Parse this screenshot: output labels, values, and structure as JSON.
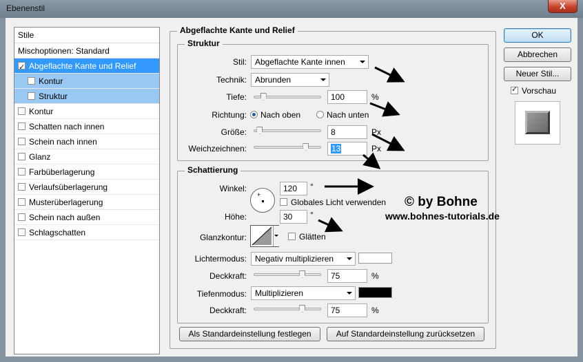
{
  "window": {
    "title": "Ebenenstil",
    "close_label": "X"
  },
  "styles_list": {
    "header": "Stile",
    "blend_options": "Mischoptionen: Standard",
    "items": [
      {
        "label": "Abgeflachte Kante und Relief",
        "checked": true,
        "selected": true,
        "sub": false
      },
      {
        "label": "Kontur",
        "checked": false,
        "selected": false,
        "sub": true
      },
      {
        "label": "Struktur",
        "checked": false,
        "selected": false,
        "sub": true
      },
      {
        "label": "Kontur",
        "checked": false,
        "selected": false,
        "sub": false
      },
      {
        "label": "Schatten nach innen",
        "checked": false,
        "selected": false,
        "sub": false
      },
      {
        "label": "Schein nach innen",
        "checked": false,
        "selected": false,
        "sub": false
      },
      {
        "label": "Glanz",
        "checked": false,
        "selected": false,
        "sub": false
      },
      {
        "label": "Farbüberlagerung",
        "checked": false,
        "selected": false,
        "sub": false
      },
      {
        "label": "Verlaufsüberlagerung",
        "checked": false,
        "selected": false,
        "sub": false
      },
      {
        "label": "Musterüberlagerung",
        "checked": false,
        "selected": false,
        "sub": false
      },
      {
        "label": "Schein nach außen",
        "checked": false,
        "selected": false,
        "sub": false
      },
      {
        "label": "Schlagschatten",
        "checked": false,
        "selected": false,
        "sub": false
      }
    ]
  },
  "bevel": {
    "title": "Abgeflachte Kante und Relief",
    "structure": {
      "title": "Struktur",
      "style_label": "Stil:",
      "style_value": "Abgeflachte Kante innen",
      "technique_label": "Technik:",
      "technique_value": "Abrunden",
      "depth_label": "Tiefe:",
      "depth_value": "100",
      "depth_unit": "%",
      "depth_fraction": 0.1,
      "direction_label": "Richtung:",
      "direction_up": "Nach oben",
      "direction_down": "Nach unten",
      "size_label": "Größe:",
      "size_value": "8",
      "size_unit": "Px",
      "size_fraction": 0.04,
      "soften_label": "Weichzeichnen:",
      "soften_value": "13",
      "soften_unit": "Px",
      "soften_fraction": 0.81
    },
    "shading": {
      "title": "Schattierung",
      "angle_label": "Winkel:",
      "angle_value": "120",
      "angle_unit": "°",
      "global_light_label": "Globales Licht verwenden",
      "altitude_label": "Höhe:",
      "altitude_value": "30",
      "altitude_unit": "°",
      "gloss_label": "Glanzkontur:",
      "antialias_label": "Glätten",
      "highlight_mode_label": "Lichtermodus:",
      "highlight_mode_value": "Negativ multiplizieren",
      "highlight_color": "#ffffff",
      "highlight_opacity_label": "Deckkraft:",
      "highlight_opacity_value": "75",
      "highlight_opacity_unit": "%",
      "highlight_opacity_fraction": 0.75,
      "shadow_mode_label": "Tiefenmodus:",
      "shadow_mode_value": "Multiplizieren",
      "shadow_color": "#000000",
      "shadow_opacity_label": "Deckkraft:",
      "shadow_opacity_value": "75",
      "shadow_opacity_unit": "%",
      "shadow_opacity_fraction": 0.75
    },
    "make_default": "Als Standardeinstellung festlegen",
    "reset_default": "Auf Standardeinstellung zurücksetzen"
  },
  "buttons": {
    "ok": "OK",
    "cancel": "Abbrechen",
    "new_style": "Neuer Stil...",
    "preview_label": "Vorschau"
  },
  "watermark": {
    "line1": "© by Bohne",
    "line2": "www.bohnes-tutorials.de"
  }
}
